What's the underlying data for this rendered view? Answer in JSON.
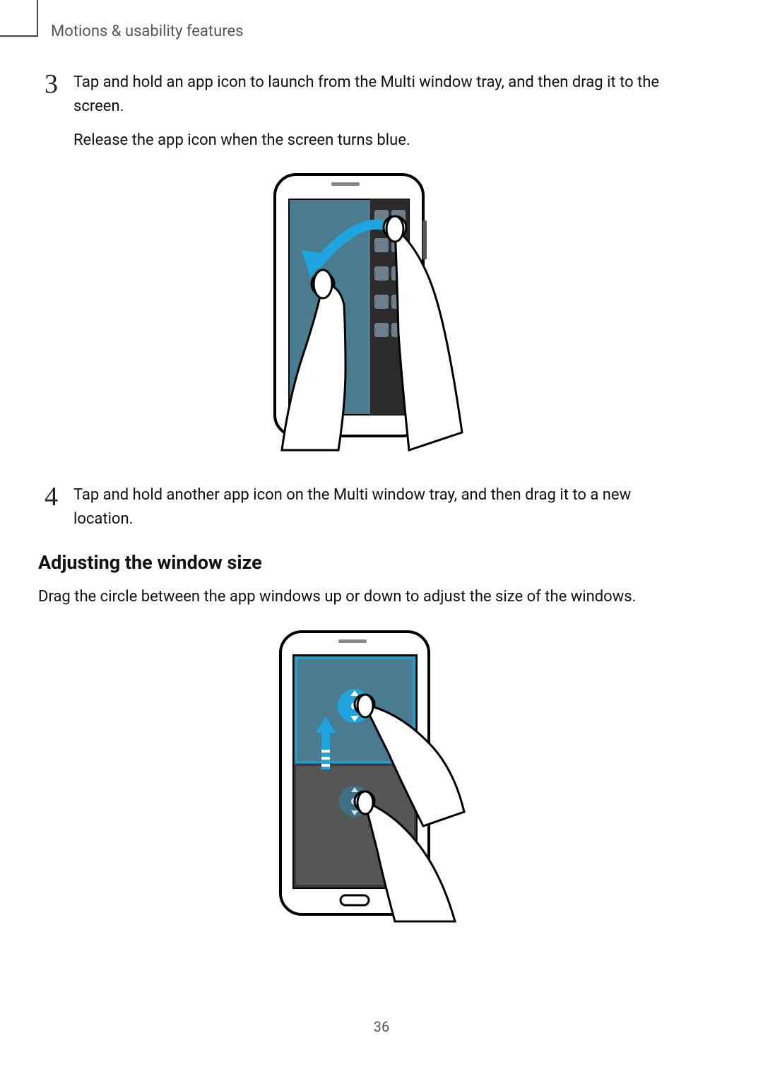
{
  "breadcrumb": "Motions & usability features",
  "step3": {
    "num": "3",
    "para1": "Tap and hold an app icon to launch from the Multi window tray, and then drag it to the screen.",
    "para2": "Release the app icon when the screen turns blue."
  },
  "step4": {
    "num": "4",
    "para1": "Tap and hold another app icon on the Multi window tray, and then drag it to a new location."
  },
  "subheading": "Adjusting the window size",
  "body": "Drag the circle between the app windows up or down to adjust the size of the windows.",
  "page": "36"
}
